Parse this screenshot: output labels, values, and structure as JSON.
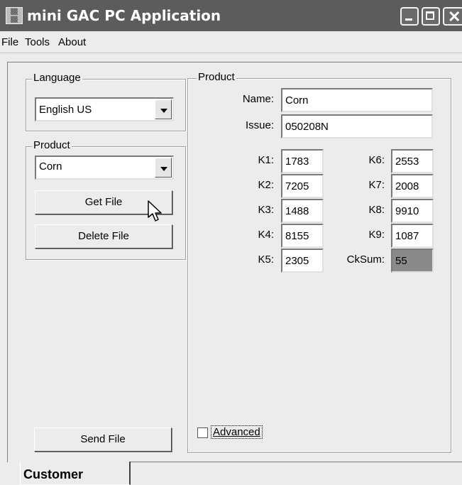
{
  "window": {
    "title": "mini GAC PC Application",
    "icon": "app-icon"
  },
  "menu": [
    "File",
    "Tools",
    "About"
  ],
  "language_group": {
    "label": "Language",
    "selected": "English US"
  },
  "product_group": {
    "label": "Product",
    "selected": "Corn",
    "get_file_label": "Get File",
    "delete_file_label": "Delete File"
  },
  "send_file_label": "Send File",
  "product_panel": {
    "label": "Product",
    "name_label": "Name:",
    "name_value": "Corn",
    "issue_label": "Issue:",
    "issue_value": "050208N",
    "k_left": [
      {
        "label": "K1:",
        "value": "1783"
      },
      {
        "label": "K2:",
        "value": "7205"
      },
      {
        "label": "K3:",
        "value": "1488"
      },
      {
        "label": "K4:",
        "value": "8155"
      },
      {
        "label": "K5:",
        "value": "2305"
      }
    ],
    "k_right": [
      {
        "label": "K6:",
        "value": "2553"
      },
      {
        "label": "K7:",
        "value": "2008"
      },
      {
        "label": "K8:",
        "value": "9910"
      },
      {
        "label": "K9:",
        "value": "1087"
      },
      {
        "label": "CkSum:",
        "value": "55"
      }
    ],
    "advanced_label": "Advanced",
    "advanced_checked": false
  },
  "tabs": [
    {
      "label": "Customer",
      "active": true
    }
  ]
}
